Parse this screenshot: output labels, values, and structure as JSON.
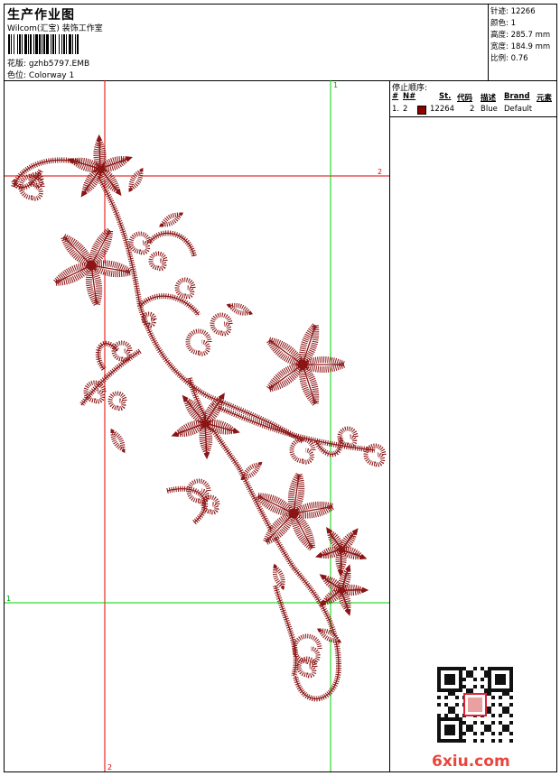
{
  "header": {
    "title": "生产作业图",
    "studio": "Wilcom(汇宝) 装饰工作室",
    "file_label": "花版:",
    "file_name": "gzhb5797.EMB",
    "colorway_label": "色位:",
    "colorway_name": "Colorway 1"
  },
  "stats": [
    {
      "label": "针迹:",
      "value": "12266"
    },
    {
      "label": "颜色:",
      "value": "1"
    },
    {
      "label": "高度:",
      "value": "285.7 mm"
    },
    {
      "label": "宽度:",
      "value": "184.9 mm"
    },
    {
      "label": "比例:",
      "value": "0.76"
    }
  ],
  "canvas": {
    "guide_labels": {
      "v1_top": "1",
      "h2_right": "2",
      "h1_left": "1",
      "v2_bottom": "2"
    },
    "thread_color": "#8b1414",
    "guide_red": "#e00000",
    "guide_green": "#00d000"
  },
  "stop_panel": {
    "title": "停止顺序:",
    "headers": [
      "#",
      "N#",
      "St.",
      "代码",
      "描述",
      "Brand",
      "元素"
    ],
    "rows": [
      {
        "index": "1.",
        "n": "2",
        "swatch": "#8b0000",
        "stitches": "12264",
        "code": "2",
        "desc": "Blue",
        "brand": "Default",
        "element": ""
      }
    ]
  },
  "watermark": {
    "text": "6xiu.com",
    "color": "#e8463c"
  }
}
